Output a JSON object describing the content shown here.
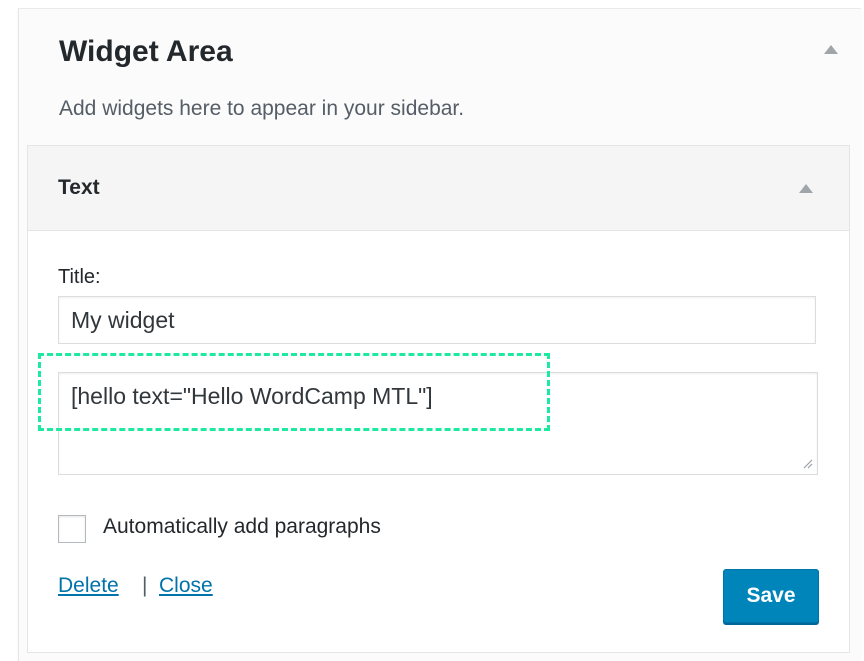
{
  "widget_area": {
    "title": "Widget Area",
    "description": "Add widgets here to appear in your sidebar."
  },
  "widget": {
    "name": "Text",
    "title_label": "Title:",
    "title_value": "My widget",
    "content_value": "[hello text=\"Hello WordCamp MTL\"]",
    "auto_paragraphs_label": "Automatically add paragraphs",
    "auto_paragraphs_checked": false,
    "delete_label": "Delete",
    "separator": "|",
    "close_label": "Close",
    "save_label": "Save"
  },
  "colors": {
    "link": "#0073aa",
    "primary_button": "#0085ba",
    "highlight_dash": "#1de9a0"
  },
  "icons": {
    "area_toggle": "arrow-up-icon",
    "widget_toggle": "arrow-up-icon",
    "resize": "resize-grip-icon"
  }
}
